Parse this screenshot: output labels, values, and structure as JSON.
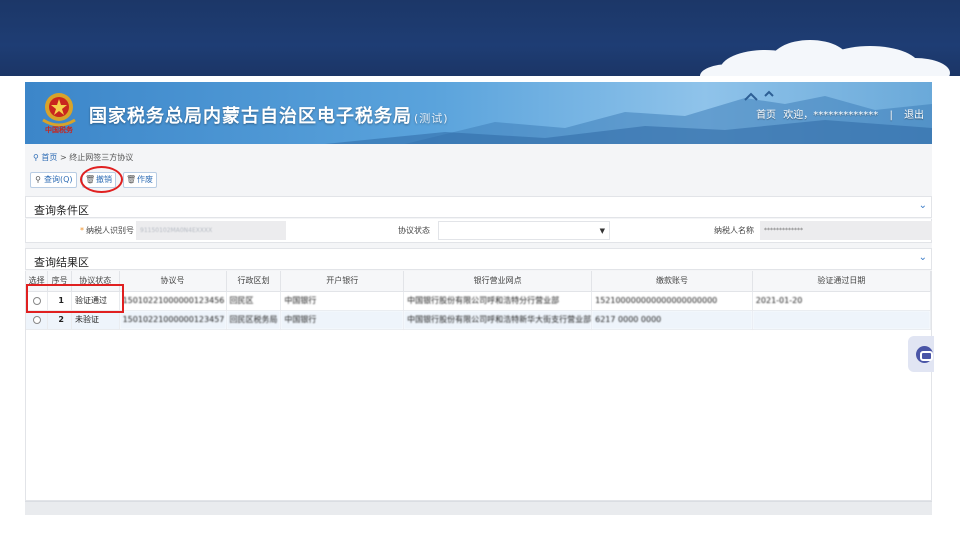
{
  "app": {
    "title": "国家税务总局内蒙古自治区电子税务局",
    "title_suffix": "(测试)",
    "emblem_caption": "中国税务"
  },
  "top_links": {
    "home": "首页",
    "welcome": "欢迎，",
    "user": "*************",
    "sep": "|",
    "logout": "退出"
  },
  "breadcrumb": {
    "home": "首页",
    "sep": ">",
    "current": "终止网签三方协议"
  },
  "toolbar": {
    "query": "查询(Q)",
    "revoke": "撤销",
    "void": "作废"
  },
  "query_section": {
    "title": "查询条件区",
    "taxpayer_id_label": "纳税人识别号",
    "taxpayer_id_value": "91150102MA0N4EXXXX",
    "status_label": "协议状态",
    "status_value": "",
    "taxpayer_name_label": "纳税人名称",
    "taxpayer_name_value": "*************"
  },
  "result_section": {
    "title": "查询结果区",
    "columns": [
      "选择",
      "序号",
      "协议状态",
      "协议号",
      "行政区划",
      "开户银行",
      "银行营业网点",
      "缴款账号",
      "验证通过日期"
    ],
    "rows": [
      {
        "no": "1",
        "status": "验证通过",
        "agreement_no": "15010221000000123456",
        "region": "回民区",
        "bank": "中国银行",
        "branch": "中国银行股份有限公司呼和浩特分行营业部",
        "account": "152100000000000000000000",
        "verify_date": "2021-01-20"
      },
      {
        "no": "2",
        "status": "未验证",
        "agreement_no": "15010221000000123457",
        "region": "回民区税务局",
        "bank": "中国银行",
        "branch": "中国银行股份有限公司呼和浩特新华大街支行营业部",
        "account": "6217 0000 0000",
        "verify_date": ""
      }
    ]
  },
  "colors": {
    "banner": "#1e3d74",
    "header": "#4a95d4",
    "accent": "#2f6db5",
    "highlight": "#e02020",
    "row_alt": "#eef4fb"
  }
}
